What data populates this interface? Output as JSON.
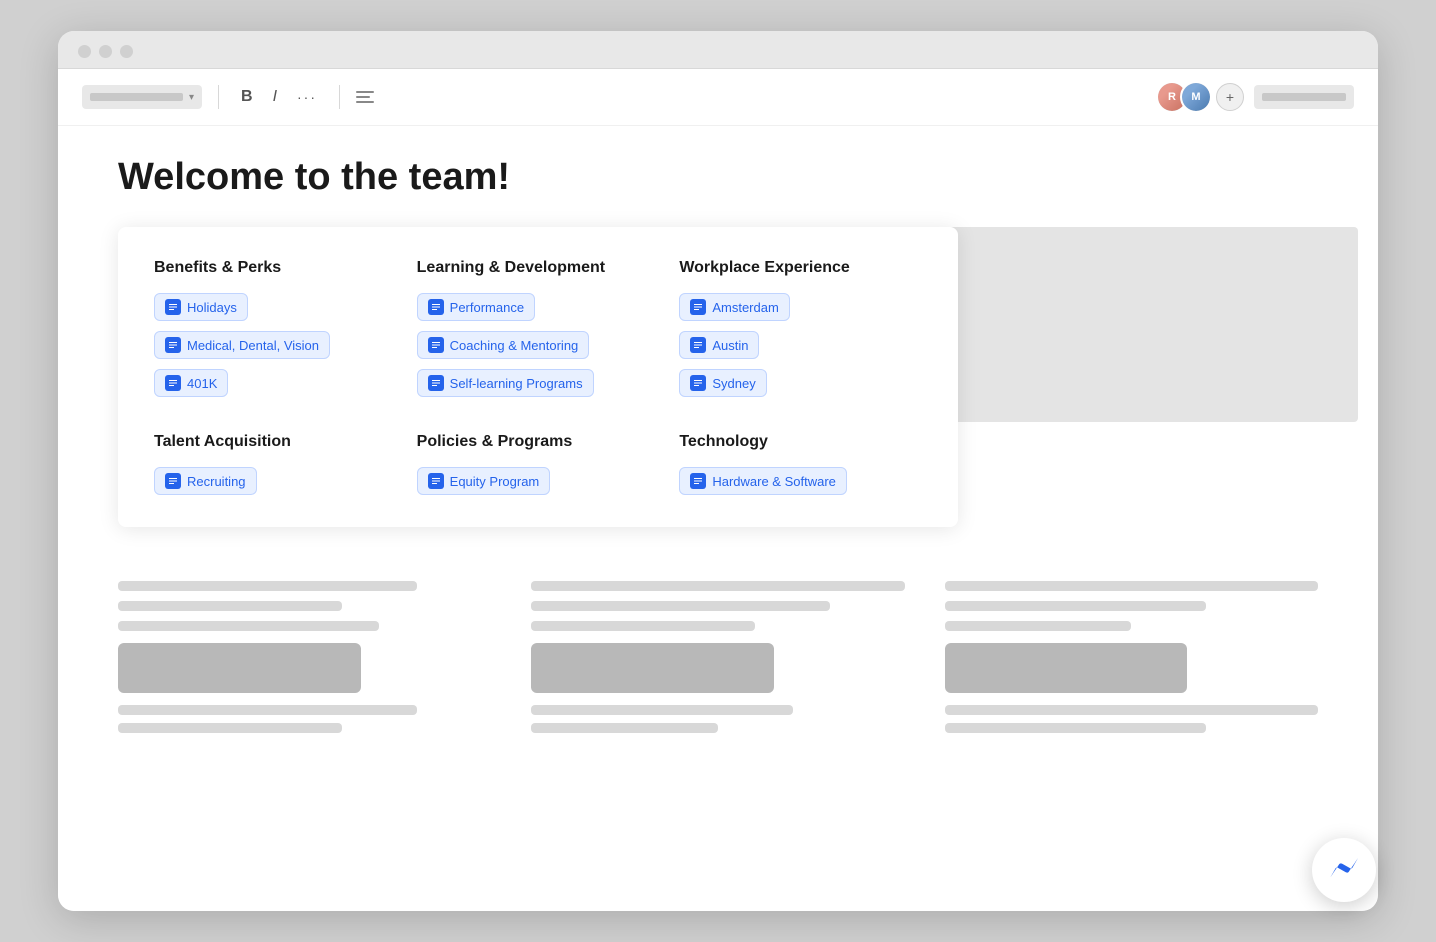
{
  "toolbar": {
    "bold_label": "B",
    "italic_label": "I",
    "dots_label": "···",
    "plus_label": "+",
    "avatar1_initials": "R",
    "avatar2_initials": "M"
  },
  "page": {
    "title": "Welcome to the team!"
  },
  "categories": [
    {
      "id": "benefits",
      "title": "Benefits & Perks",
      "items": [
        {
          "label": "Holidays"
        },
        {
          "label": "Medical, Dental, Vision"
        },
        {
          "label": "401K"
        }
      ]
    },
    {
      "id": "learning",
      "title": "Learning & Development",
      "items": [
        {
          "label": "Performance"
        },
        {
          "label": "Coaching & Mentoring"
        },
        {
          "label": "Self-learning Programs"
        }
      ]
    },
    {
      "id": "workplace",
      "title": "Workplace Experience",
      "items": [
        {
          "label": "Amsterdam"
        },
        {
          "label": "Austin"
        },
        {
          "label": "Sydney"
        }
      ]
    },
    {
      "id": "talent",
      "title": "Talent Acquisition",
      "items": [
        {
          "label": "Recruiting"
        }
      ]
    },
    {
      "id": "policies",
      "title": "Policies & Programs",
      "items": [
        {
          "label": "Equity Program"
        }
      ]
    },
    {
      "id": "technology",
      "title": "Technology",
      "items": [
        {
          "label": "Hardware & Software"
        }
      ]
    }
  ],
  "fab": {
    "label": "✕"
  }
}
